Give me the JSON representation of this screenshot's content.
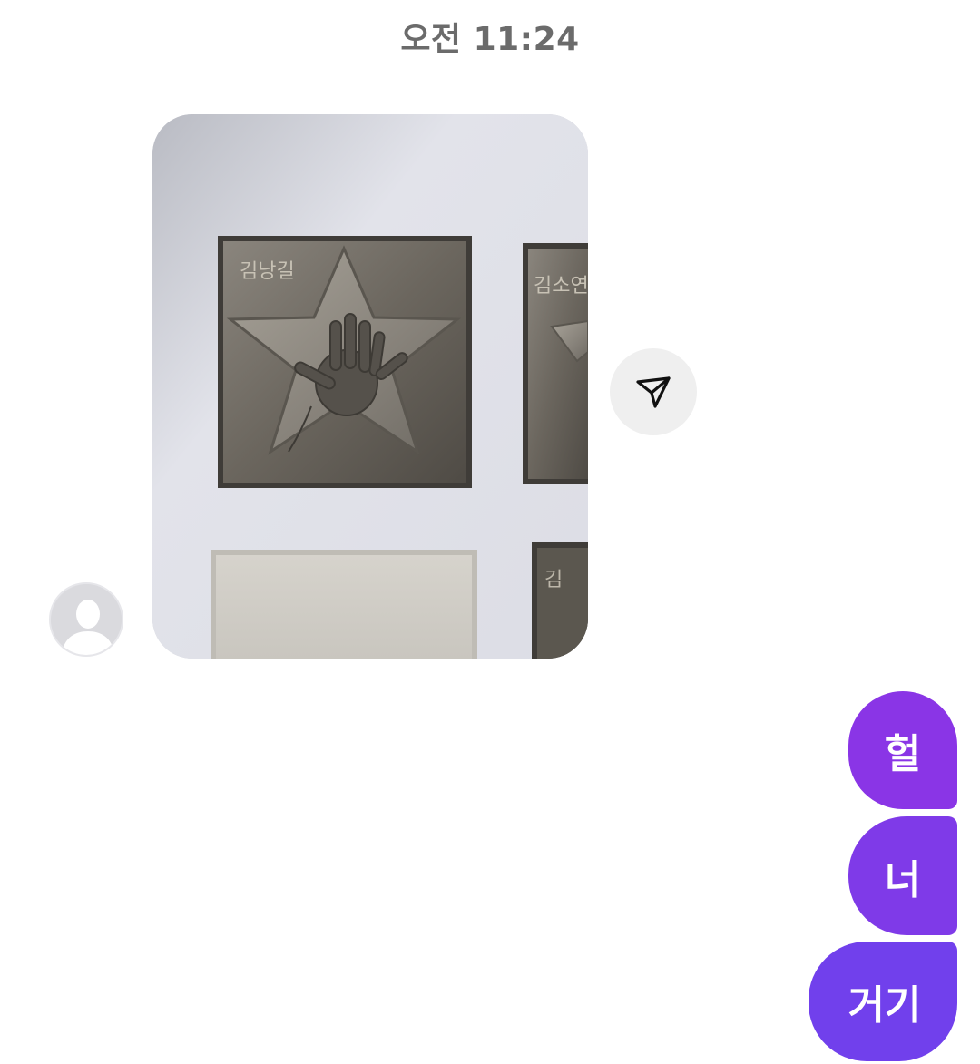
{
  "header": {
    "timestamp": "오전 11:24"
  },
  "incoming": {
    "avatar_icon": "default-user-avatar-icon",
    "photo": {
      "plaque_left_name": "김낭길",
      "plaque_right_name": "김소연",
      "plaque_bottom_name": "김"
    },
    "share_icon": "send-paper-plane-icon"
  },
  "outgoing": {
    "bubble_color": "#7a3ae8",
    "messages": [
      "헐",
      "너",
      "거기"
    ]
  }
}
